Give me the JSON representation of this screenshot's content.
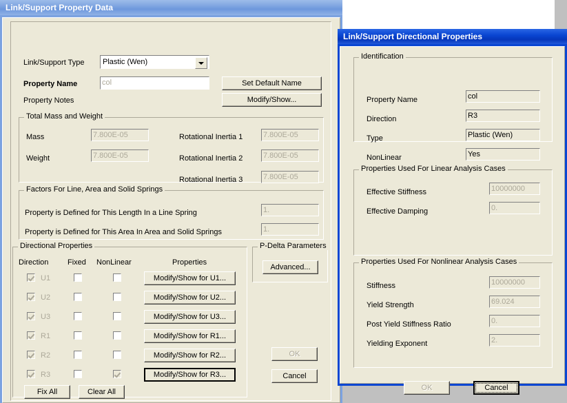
{
  "colors": {
    "dialog_face": "#ece9d8",
    "titlebar_active": "#0a46d2",
    "titlebar_inactive": "#7ba2e0",
    "desktop_gray": "#c0c0c0",
    "disabled_text": "#aca899"
  },
  "property_dialog": {
    "title": "Link/Support Property Data",
    "link_type": {
      "label": "Link/Support Type",
      "value": "Plastic (Wen)"
    },
    "property_name": {
      "label": "Property Name",
      "value": "col"
    },
    "property_notes_label": "Property Notes",
    "set_default_name_button": "Set Default Name",
    "modify_show_button": "Modify/Show...",
    "mass_weight_group": {
      "title": "Total Mass and Weight",
      "rows": [
        {
          "label": "Mass",
          "value": "7.800E-05"
        },
        {
          "label": "Weight",
          "value": "7.800E-05"
        }
      ],
      "inertia_rows": [
        {
          "label": "Rotational Inertia 1",
          "value": "7.800E-05"
        },
        {
          "label": "Rotational Inertia 2",
          "value": "7.800E-05"
        },
        {
          "label": "Rotational Inertia 3",
          "value": "7.800E-05"
        }
      ]
    },
    "factors_group": {
      "title": "Factors For Line, Area and Solid Springs",
      "rows": [
        {
          "label": "Property is Defined for This Length In a Line Spring",
          "value": "1."
        },
        {
          "label": "Property is Defined for This Area In Area and Solid Springs",
          "value": "1."
        }
      ]
    },
    "directional_group": {
      "title": "Directional Properties",
      "headers": {
        "direction": "Direction",
        "fixed": "Fixed",
        "nonlinear": "NonLinear",
        "properties": "Properties"
      },
      "rows": [
        {
          "direction": "U1",
          "direction_checked": true,
          "fixed": false,
          "nonlinear": false,
          "button": "Modify/Show for U1...",
          "button_default": false
        },
        {
          "direction": "U2",
          "direction_checked": true,
          "fixed": false,
          "nonlinear": false,
          "button": "Modify/Show for U2...",
          "button_default": false
        },
        {
          "direction": "U3",
          "direction_checked": true,
          "fixed": false,
          "nonlinear": false,
          "button": "Modify/Show for U3...",
          "button_default": false
        },
        {
          "direction": "R1",
          "direction_checked": true,
          "fixed": false,
          "nonlinear": false,
          "button": "Modify/Show for R1...",
          "button_default": false
        },
        {
          "direction": "R2",
          "direction_checked": true,
          "fixed": false,
          "nonlinear": false,
          "button": "Modify/Show for R2...",
          "button_default": false
        },
        {
          "direction": "R3",
          "direction_checked": true,
          "fixed": false,
          "nonlinear": true,
          "button": "Modify/Show for R3...",
          "button_default": true
        }
      ],
      "fix_all_button": "Fix All",
      "clear_all_button": "Clear All"
    },
    "pdelta_group": {
      "title": "P-Delta Parameters",
      "advanced_button": "Advanced..."
    },
    "ok_button": "OK",
    "cancel_button": "Cancel"
  },
  "directional_dialog": {
    "title": "Link/Support Directional Properties",
    "identification_group": {
      "title": "Identification",
      "rows": [
        {
          "label": "Property Name",
          "value": "col"
        },
        {
          "label": "Direction",
          "value": "R3"
        },
        {
          "label": "Type",
          "value": "Plastic (Wen)"
        },
        {
          "label": "NonLinear",
          "value": "Yes"
        }
      ]
    },
    "linear_group": {
      "title": "Properties Used For Linear Analysis Cases",
      "rows": [
        {
          "label": "Effective Stiffness",
          "value": "10000000"
        },
        {
          "label": "Effective Damping",
          "value": "0."
        }
      ]
    },
    "nonlinear_group": {
      "title": "Properties Used For Nonlinear Analysis Cases",
      "rows": [
        {
          "label": "Stiffness",
          "value": "10000000"
        },
        {
          "label": "Yield Strength",
          "value": "69.024"
        },
        {
          "label": "Post Yield Stiffness Ratio",
          "value": "0."
        },
        {
          "label": "Yielding Exponent",
          "value": "2."
        }
      ]
    },
    "ok_button": "OK",
    "cancel_button": "Cancel"
  }
}
